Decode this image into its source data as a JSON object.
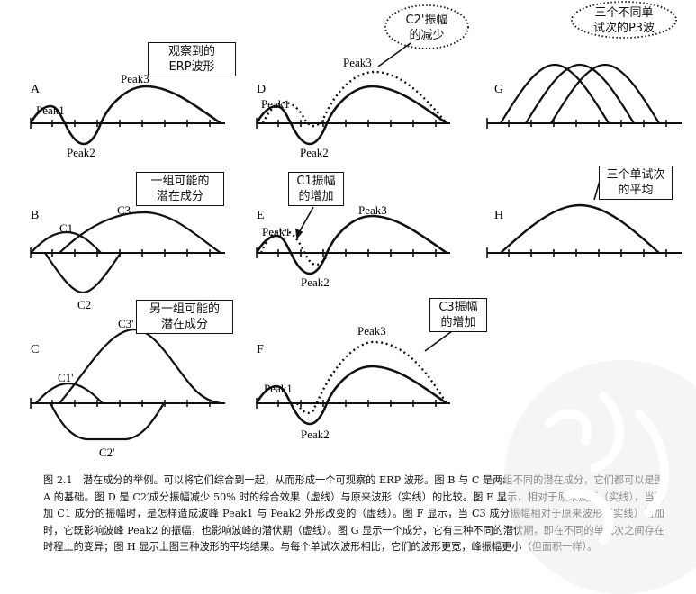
{
  "panels": {
    "A": {
      "letter": "A",
      "labels": [
        "Peak1",
        "Peak2",
        "Peak3"
      ]
    },
    "B": {
      "letter": "B",
      "labels": [
        "C1",
        "C2",
        "C3"
      ]
    },
    "C": {
      "letter": "C",
      "labels": [
        "C1'",
        "C2'",
        "C3'"
      ]
    },
    "D": {
      "letter": "D",
      "labels": [
        "Peak1",
        "Peak2",
        "Peak3"
      ]
    },
    "E": {
      "letter": "E",
      "labels": [
        "Peak1",
        "Peak2",
        "Peak3"
      ]
    },
    "F": {
      "letter": "F",
      "labels": [
        "Peak1",
        "Peak2",
        "Peak3"
      ]
    },
    "G": {
      "letter": "G"
    },
    "H": {
      "letter": "H"
    }
  },
  "callouts": {
    "a": "观察到的ERP波形",
    "b": "一组可能的潜在成分",
    "c": "另一组可能的潜在成分",
    "d": "C2'振幅的减少",
    "e": "C1振幅的增加",
    "f": "C3振幅的增加",
    "g": "三个不同单试次的P3波",
    "h": "三个单试次的平均"
  },
  "callout_lines": {
    "a": [
      "观察到的",
      "ERP波形"
    ],
    "b": [
      "一组可能的",
      "潜在成分"
    ],
    "c": [
      "另一组可能的",
      "潜在成分"
    ],
    "d": [
      "C2'振幅",
      "的减少"
    ],
    "e": [
      "C1振幅",
      "的增加"
    ],
    "f": [
      "C3振幅",
      "的增加"
    ],
    "g": [
      "三个不同单",
      "试次的P3波"
    ],
    "h": [
      "三个单试次",
      "的平均"
    ]
  },
  "caption": "图 2.1　潜在成分的举例。可以将它们综合到一起，从而形成一个可观察的 ERP 波形。图 B 与 C 是两组不同的潜在成分，它们都可以是图 A 的基础。图 D 是 C2′成分振幅减少 50% 时的综合效果（虚线）与原来波形（实线）的比较。图 E 显示，相对于原来波形（实线），当增加 C1 成分的振幅时，是怎样造成波峰 Peak1 与 Peak2 外形改变的（虚线）。图 F 显示，当 C3 成分振幅相对于原来波形（实线）增加时，它既影响波峰 Peak2 的振幅，也影响波峰的潜伏期（虚线）。图 G 显示一个成分，它有三种不同的潜伏期，即在不同的单试次之间存在时程上的变异；图 H 显示上图三种波形的平均结果。与每个单试次波形相比，它们的波形更宽，峰振幅更小（但面积一样）。"
}
